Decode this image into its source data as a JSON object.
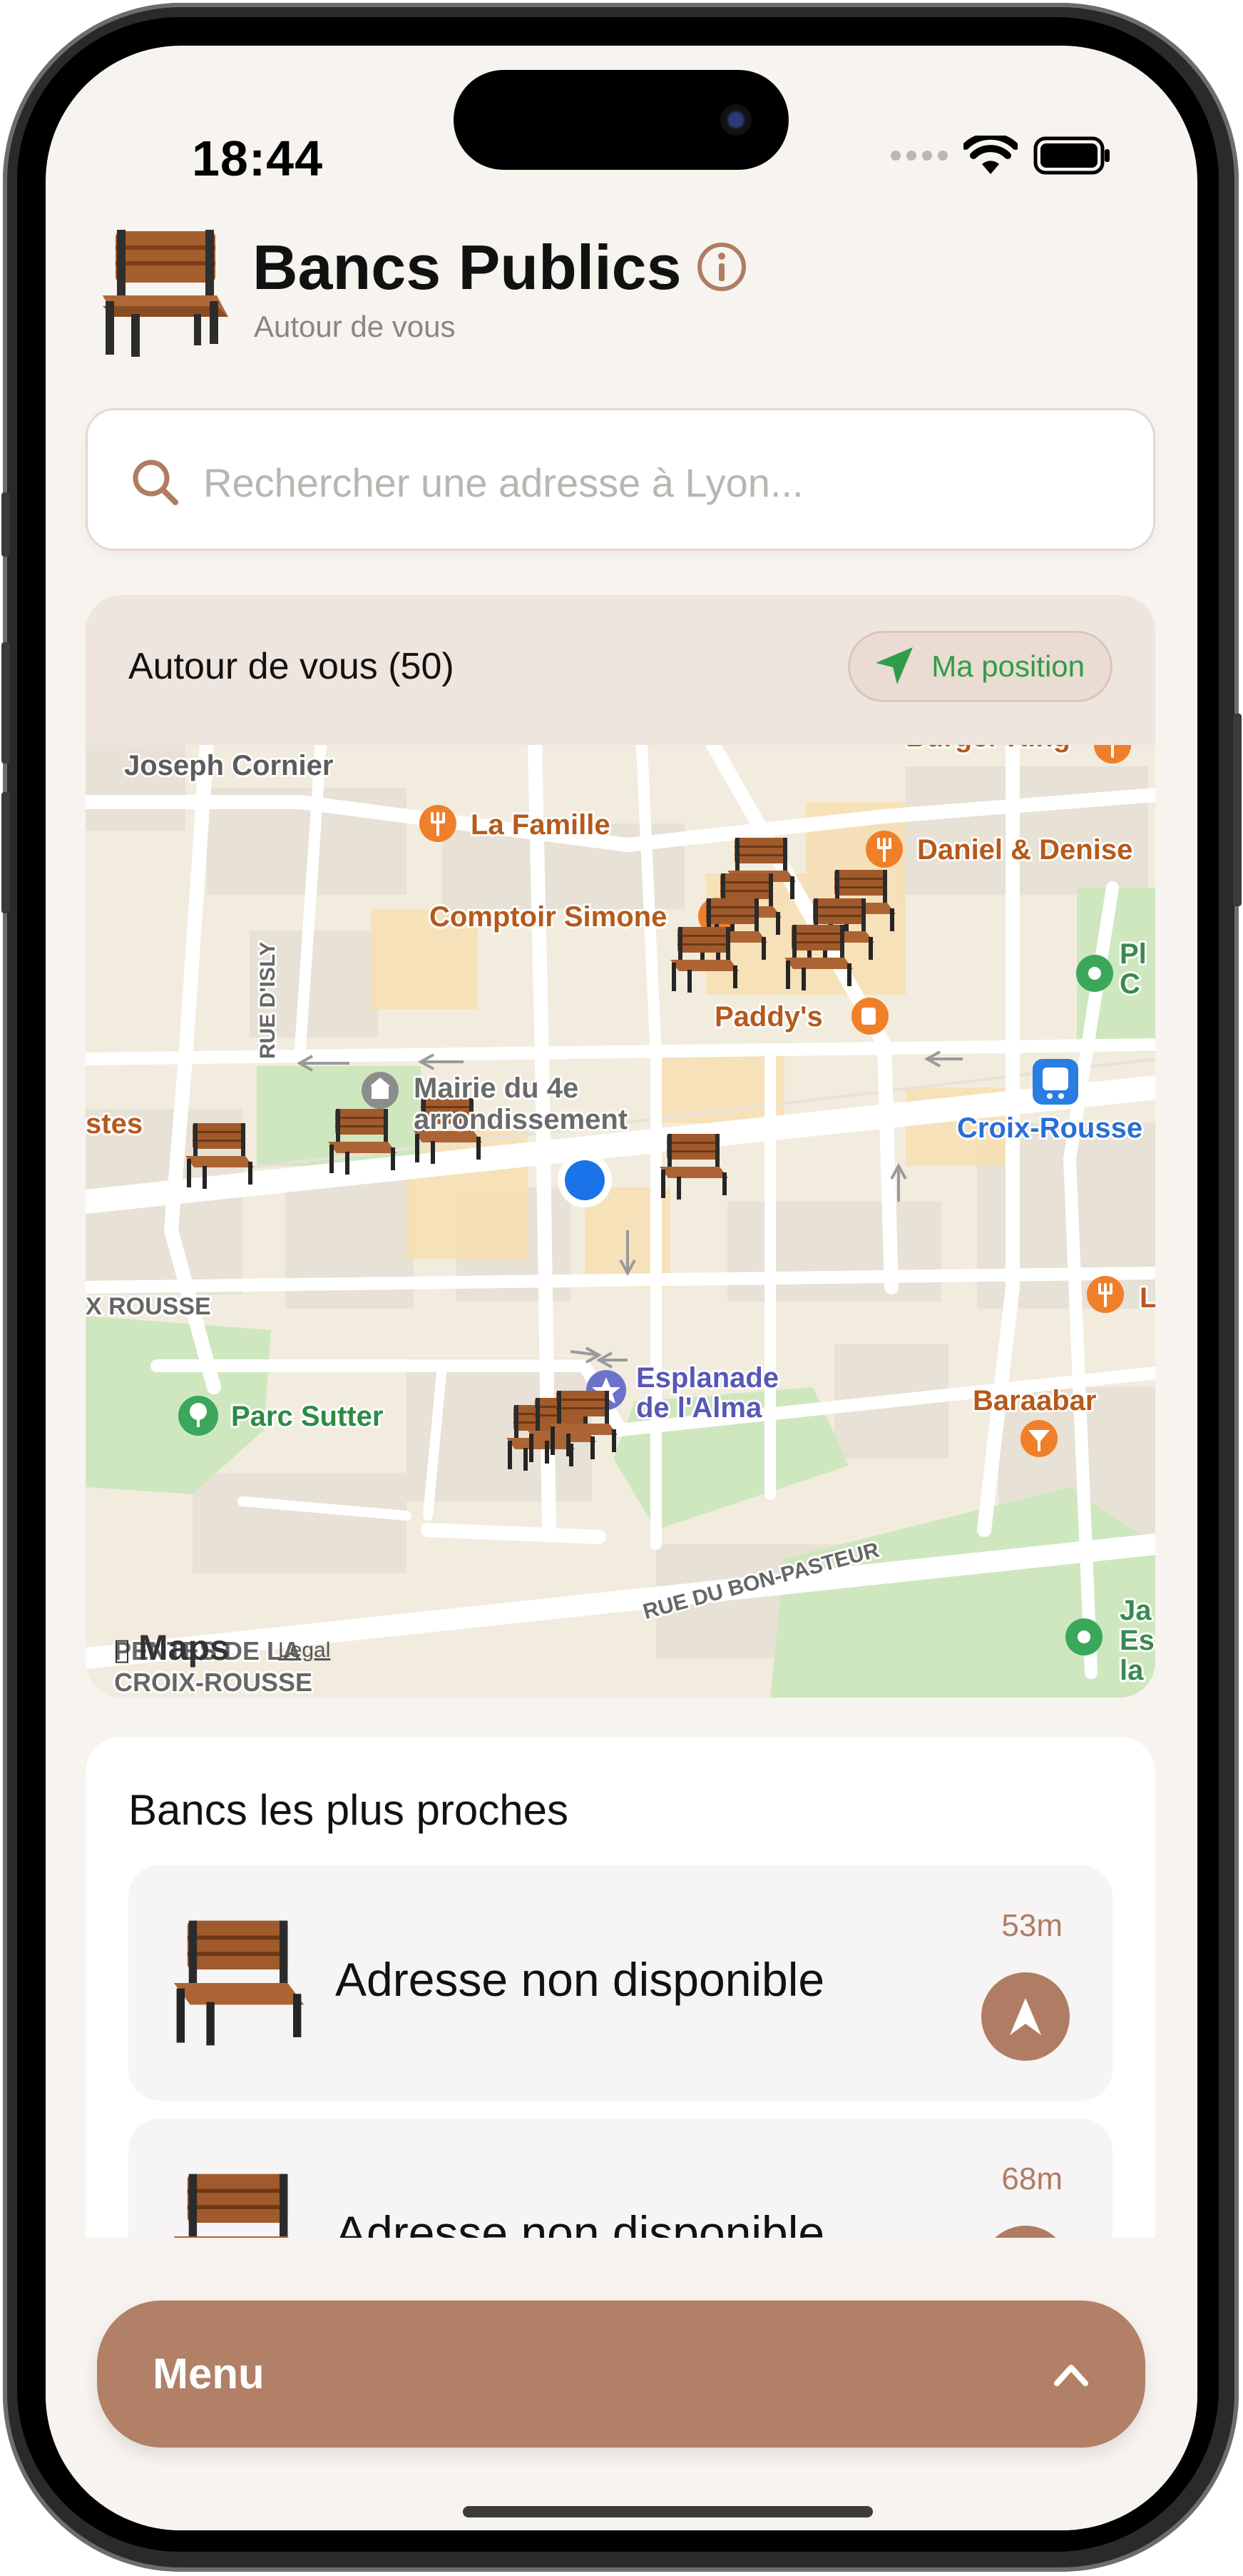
{
  "status_bar": {
    "time": "18:44"
  },
  "header": {
    "title": "Bancs Publics",
    "subtitle": "Autour de vous"
  },
  "search": {
    "placeholder": "Rechercher une adresse à Lyon..."
  },
  "map_card": {
    "title": "Autour de vous (50)",
    "position_button_label": "Ma position",
    "map_labels": {
      "joseph_cornier": "Joseph Cornier",
      "burger_king": "Burger King",
      "la_famille": "La Famille",
      "daniel_denise": "Daniel & Denise",
      "comptoir_simone": "Comptoir Simone",
      "paddys": "Paddy's",
      "pl": "Pl",
      "c": "C",
      "rue_disly": "RUE D'ISLY",
      "mairie_line1": "Mairie du 4e",
      "mairie_line2": "arrondissement",
      "croix_rousse": "Croix-Rousse",
      "stes": "stes",
      "x_rousse": "X ROUSSE",
      "l": "L",
      "parc_sutter": "Parc Sutter",
      "esplanade_line1": "Esplanade",
      "esplanade_line2": "de l'Alma",
      "baraabar": "Baraabar",
      "rue_bon_pasteur": "RUE DU BON-PASTEUR",
      "ja": "Ja",
      "es": "Es",
      "la": "la",
      "maps": "Maps",
      "legal": "Legal",
      "pentes_line1": "PENTES DE LA",
      "pentes_line2": "CROIX-ROUSSE"
    }
  },
  "nearest": {
    "title": "Bancs les plus proches",
    "items": [
      {
        "address": "Adresse non disponible",
        "distance": "53m"
      },
      {
        "address": "Adresse non disponible",
        "distance": "68m"
      }
    ]
  },
  "menu": {
    "label": "Menu"
  },
  "colors": {
    "accent": "#b27f67",
    "green": "#2f9d48",
    "background": "#f7f4ef",
    "user_location": "#1a73e8"
  }
}
